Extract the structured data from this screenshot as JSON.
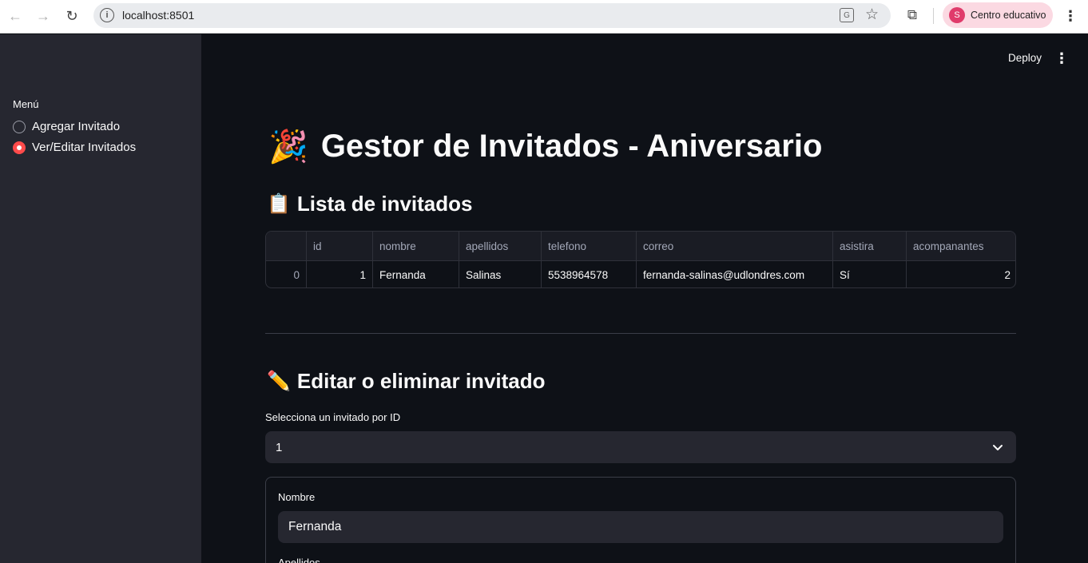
{
  "browser": {
    "url": "localhost:8501",
    "profile_initial": "S",
    "profile_name": "Centro educativo"
  },
  "header": {
    "deploy_label": "Deploy"
  },
  "sidebar": {
    "label": "Menú",
    "options": [
      {
        "label": "Agregar Invitado",
        "selected": false
      },
      {
        "label": "Ver/Editar Invitados",
        "selected": true
      }
    ]
  },
  "main": {
    "title_emoji": "🎉",
    "title": "Gestor de Invitados - Aniversario",
    "list_emoji": "📋",
    "list_heading": "Lista de invitados",
    "table": {
      "columns": [
        "",
        "id",
        "nombre",
        "apellidos",
        "telefono",
        "correo",
        "asistira",
        "acompanantes"
      ],
      "rows": [
        [
          "0",
          "1",
          "Fernanda",
          "Salinas",
          "5538964578",
          "fernanda-salinas@udlondres.com",
          "Sí",
          "2"
        ]
      ]
    },
    "edit_emoji": "✏️",
    "edit_heading": "Editar o eliminar invitado",
    "select_label": "Selecciona un invitado por ID",
    "select_value": "1",
    "form": {
      "nombre_label": "Nombre",
      "nombre_value": "Fernanda",
      "apellidos_label": "Apellidos"
    }
  },
  "colors": {
    "accent": "#ff4b4b",
    "background": "#0e1117",
    "sidebar": "#262730"
  }
}
